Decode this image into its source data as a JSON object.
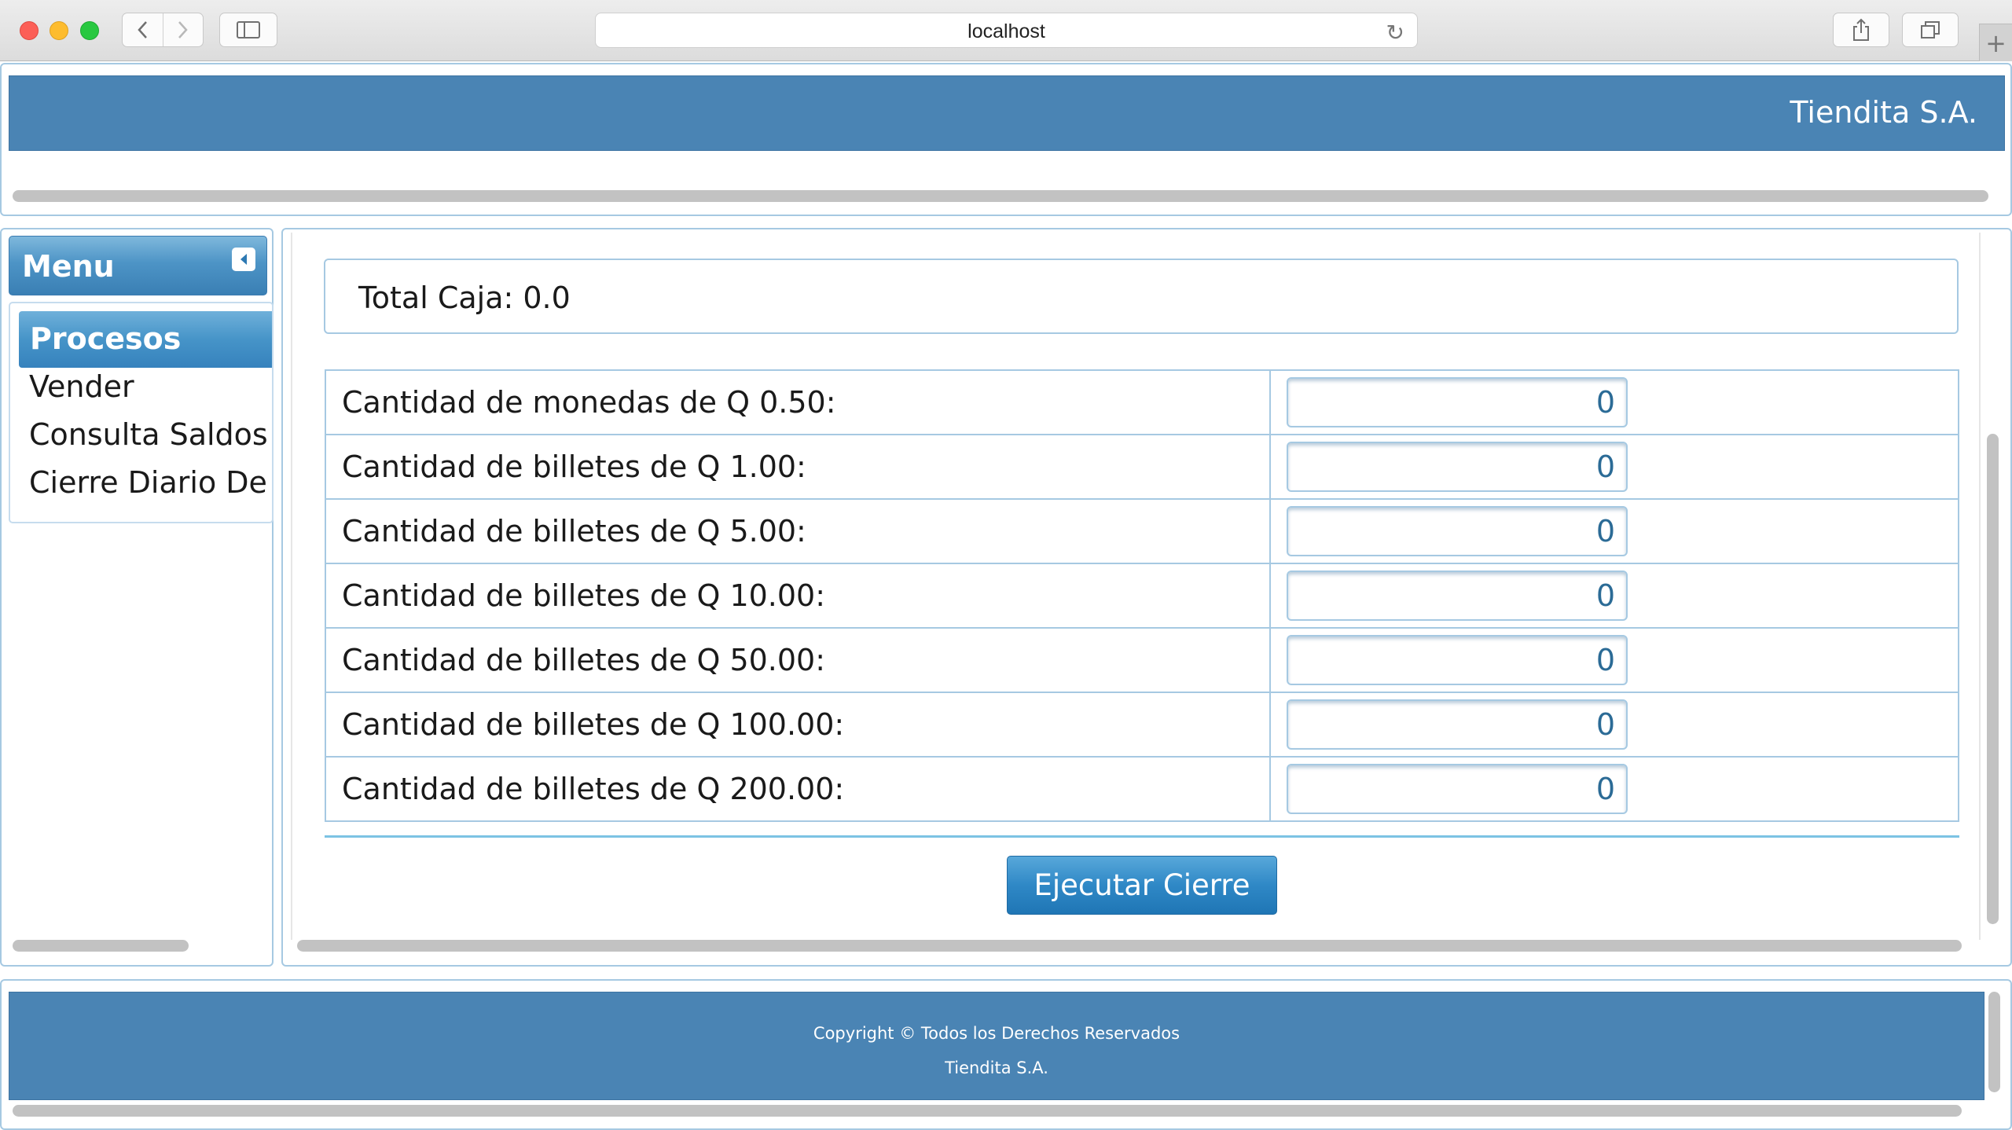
{
  "browser": {
    "url": "localhost"
  },
  "header": {
    "brand": "Tiendita S.A."
  },
  "menu": {
    "title": "Menu",
    "group_title": "Procesos",
    "items": [
      {
        "label": "Vender"
      },
      {
        "label": "Consulta Saldos"
      },
      {
        "label": "Cierre Diario De Caja"
      }
    ]
  },
  "main": {
    "total_label": "Total Caja: 0.0",
    "rows": [
      {
        "label": "Cantidad de monedas de Q 0.50:",
        "value": "0"
      },
      {
        "label": "Cantidad de billetes de Q 1.00:",
        "value": "0"
      },
      {
        "label": "Cantidad de billetes de Q 5.00:",
        "value": "0"
      },
      {
        "label": "Cantidad de billetes de Q 10.00:",
        "value": "0"
      },
      {
        "label": "Cantidad de billetes de Q 50.00:",
        "value": "0"
      },
      {
        "label": "Cantidad de billetes de Q 100.00:",
        "value": "0"
      },
      {
        "label": "Cantidad de billetes de Q 200.00:",
        "value": "0"
      }
    ],
    "submit_label": "Ejecutar Cierre"
  },
  "footer": {
    "line1": "Copyright © Todos los Derechos Reservados",
    "line2": "Tiendita S.A."
  },
  "colors": {
    "header_blue": "#4a84b4",
    "border_blue": "#a6c9e2",
    "button_blue": "#2f88c6"
  }
}
